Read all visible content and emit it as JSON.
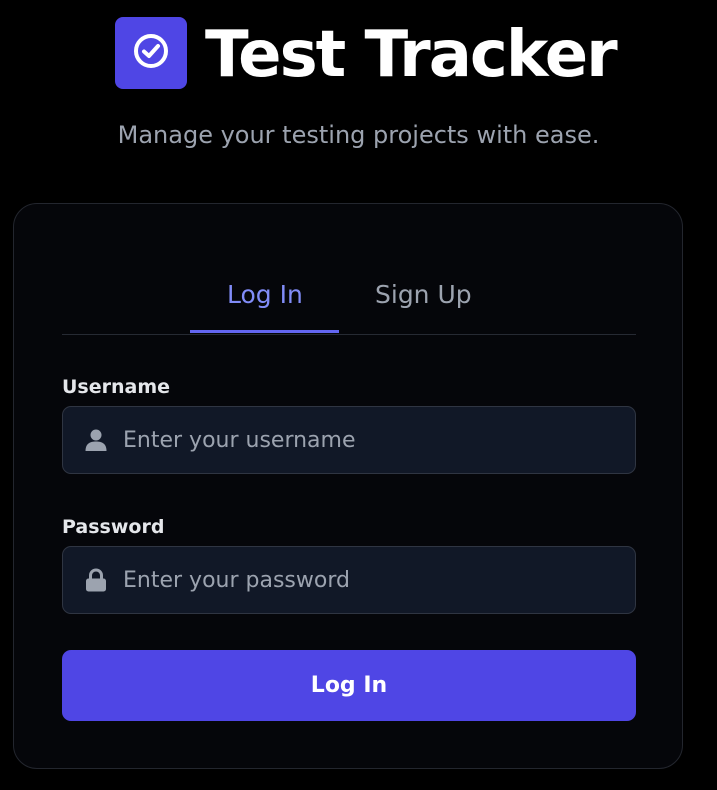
{
  "app": {
    "title": "Test Tracker",
    "tagline": "Manage your testing projects with ease.",
    "logo_icon": "check-circle-icon",
    "accent_color": "#4f46e5"
  },
  "auth": {
    "tabs": [
      {
        "label": "Log In",
        "active": true
      },
      {
        "label": "Sign Up",
        "active": false
      }
    ],
    "username": {
      "label": "Username",
      "placeholder": "Enter your username",
      "value": "",
      "icon": "user-icon"
    },
    "password": {
      "label": "Password",
      "placeholder": "Enter your password",
      "value": "",
      "icon": "lock-icon"
    },
    "submit_label": "Log In"
  }
}
